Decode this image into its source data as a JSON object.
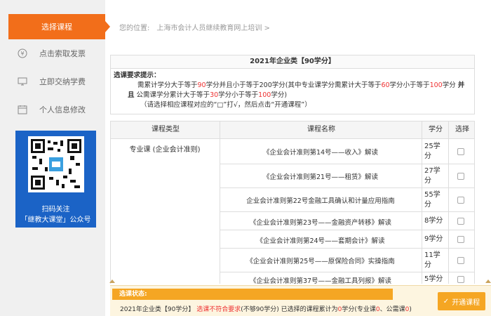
{
  "sidebar": {
    "active_label": "选择课程",
    "items": [
      {
        "label": "点击索取发票",
        "icon": "yen-icon"
      },
      {
        "label": "立即交纳学费",
        "icon": "monitor-icon"
      },
      {
        "label": "个人信息修改",
        "icon": "calendar-icon"
      }
    ],
    "qr": {
      "line1": "扫码关注",
      "line2": "「继教大课堂」公众号"
    }
  },
  "breadcrumb": {
    "prefix": "您的位置:",
    "location": "上海市会计人员继续教育网上培训 >"
  },
  "plan": {
    "title": "2021年企业类【90学分】",
    "req_title": "选课要求提示：",
    "l1_a": "需累计学分大于等于",
    "l1_n1": "90",
    "l1_b": "学分并且小于等于200学分(其中专业课学分需累计大于等于",
    "l1_n2": "60",
    "l1_c": "学分小于等于",
    "l1_n3": "100",
    "l1_d": "学分",
    "l1_e": "并",
    "l2_a": "且",
    "l2_b": "公需课学分累计大于等于",
    "l2_n1": "30",
    "l2_c": "学分小于等于",
    "l2_n2": "100",
    "l2_d": "学分)",
    "l3": "（请选择相应课程对应的“□”打√，然后点击“开通课程”）"
  },
  "table": {
    "headers": [
      "课程类型",
      "课程名称",
      "学分",
      "选择"
    ],
    "type_label": "专业课 (企业会计准则)",
    "rows": [
      {
        "name": "《企业会计准则第14号——收入》解读",
        "credit_num": "25学",
        "credit_unit": "分"
      },
      {
        "name": "《企业会计准则第21号——租赁》解读",
        "credit_num": "27学",
        "credit_unit": "分"
      },
      {
        "name": "企业会计准则第22号金融工具确认和计量应用指南",
        "credit_num": "55学",
        "credit_unit": "分"
      },
      {
        "name": "《企业会计准则第23号——金融资产转移》解读",
        "credit_num": "8学分",
        "credit_unit": ""
      },
      {
        "name": "《企业会计准则第24号——套期会计》解读",
        "credit_num": "9学分",
        "credit_unit": ""
      },
      {
        "name": "《企业会计准则第25号——原保险合同》实操指南",
        "credit_num": "11学",
        "credit_unit": "分"
      },
      {
        "name": "《企业会计准则第37号——金融工具列报》解读",
        "credit_num": "5学分",
        "credit_unit": ""
      }
    ]
  },
  "status": {
    "label": "选课状态:",
    "plan": "2021年企业类【90学分】",
    "warn": "选课不符合要求",
    "detail_a": "(不够90学分) 已选择的课程累计为",
    "total": "0",
    "detail_b": "学分(专业课",
    "pro": "0",
    "detail_c": "、公需课",
    "pub": "0",
    "detail_d": ")"
  },
  "open_button": {
    "label": "开通课程",
    "check": "✓"
  },
  "colors": {
    "accent": "#f26e1a",
    "button": "#f5a623",
    "qr_bg": "#1b63c6",
    "warn": "#e33333"
  }
}
